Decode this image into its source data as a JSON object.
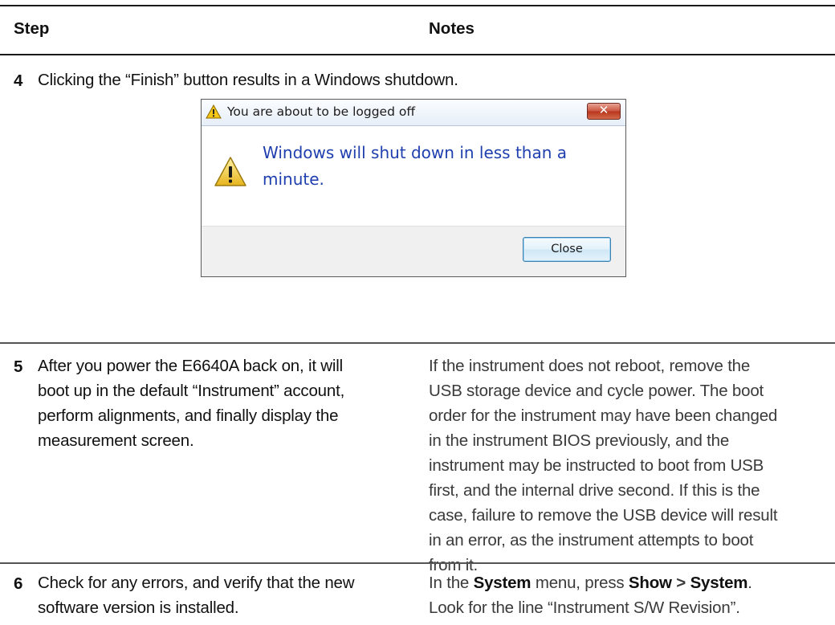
{
  "header": {
    "step": "Step",
    "notes": "Notes"
  },
  "rows": [
    {
      "num": "4",
      "step_lines": [
        "Clicking the “Finish” button results in a Windows shutdown."
      ]
    },
    {
      "num": "5",
      "step_lines": [
        "After you power the E6640A back on, it will",
        "boot up in the default “Instrument” account,",
        "perform alignments, and finally display the",
        "measurement screen."
      ],
      "note_lines": [
        "If the instrument does not reboot, remove the",
        "USB storage device and cycle power. The boot",
        "order for the instrument may have been changed",
        "in the instrument BIOS previously, and the",
        "instrument may be instructed to boot from USB",
        "first, and the internal drive second. If this is the",
        "case, failure to remove the USB device will result",
        "in an error, as the instrument attempts to boot",
        "from it."
      ]
    },
    {
      "num": "6",
      "step_lines": [
        "Check for any errors, and verify that the new",
        "software version is installed."
      ],
      "note": {
        "part1": "In the ",
        "menu": "System",
        "part2": " menu, press ",
        "key1": "Show",
        "sep": " > ",
        "key2": "System",
        "part3": ".",
        "line2": "Look for the line “Instrument S/W Revision”."
      }
    }
  ],
  "dialog": {
    "title": "You are about to be logged off",
    "close_glyph": "✕",
    "message": "Windows will shut down in less than a minute.",
    "button": "Close",
    "colors": {
      "message": "#1f3fae",
      "close_x": "#c9543f",
      "button_border": "#3c7fb1"
    }
  }
}
